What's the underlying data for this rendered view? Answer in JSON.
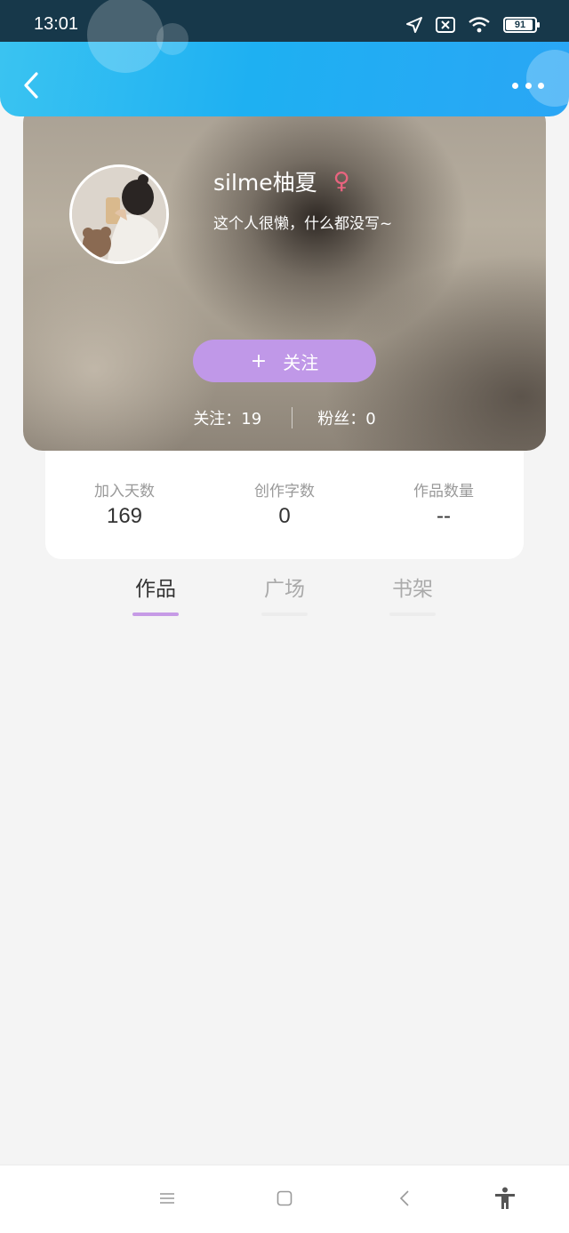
{
  "status_bar": {
    "time": "13:01",
    "battery": "91",
    "icons": [
      "location-arrow-icon",
      "no-sim-icon",
      "wifi-icon",
      "battery-icon"
    ]
  },
  "header": {
    "back_icon": "chevron-left-icon",
    "more_icon": "more-dots-icon",
    "accent_color": "#1eb0f2"
  },
  "profile": {
    "username": "silme柚夏",
    "gender_symbol": "♀",
    "gender_color": "#e8647f",
    "bio": "这个人很懒，什么都没写~",
    "follow_button": {
      "plus": "+",
      "label": "关注",
      "color": "#c098e8"
    },
    "following": "关注：19",
    "followers": "粉丝：0"
  },
  "stats": [
    {
      "label": "加入天数",
      "value": "169"
    },
    {
      "label": "创作字数",
      "value": "0"
    },
    {
      "label": "作品数量",
      "value": "--"
    }
  ],
  "tabs": [
    {
      "label": "作品",
      "active": true
    },
    {
      "label": "广场",
      "active": false
    },
    {
      "label": "书架",
      "active": false
    }
  ],
  "tab_indicator_color": "#c69ae6",
  "nav_bar": {
    "icons": [
      "menu-icon",
      "home-square-icon",
      "back-triangle-icon",
      "accessibility-icon"
    ]
  }
}
